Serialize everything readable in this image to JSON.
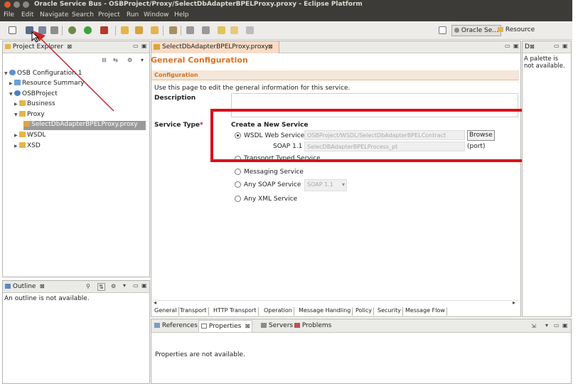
{
  "window": {
    "title": "Oracle Service Bus - OSBProject/Proxy/SelectDbAdapterBPELProxy.proxy - Eclipse Platform",
    "buttons": {
      "close_color": "#e05a2b",
      "min_color": "#8a887f",
      "max_color": "#8a887f"
    }
  },
  "menu": {
    "items": [
      "File",
      "Edit",
      "Navigate",
      "Search",
      "Project",
      "Run",
      "Window",
      "Help"
    ]
  },
  "toolbar": {
    "perspective_oracle": "Oracle Se...",
    "perspective_resource": "Resource"
  },
  "project_explorer": {
    "tab_label": "Project Explorer",
    "tree": {
      "root": "OSB Configuration 1",
      "resource_summary": "Resource Summary",
      "project": "OSBProject",
      "business": "Business",
      "proxy": "Proxy",
      "proxy_file": "SelectDbAdapterBPELProxy.proxy",
      "wsdl": "WSDL",
      "xsd": "XSD"
    }
  },
  "outline": {
    "tab_label": "Outline",
    "message": "An outline is not available."
  },
  "palette": {
    "tab_label": "D",
    "message_line1": "A palette is",
    "message_line2": "not available."
  },
  "editor": {
    "tab_label": "SelectDbAdapterBPELProxy.proxy",
    "heading": "General Configuration",
    "section": "Configuration",
    "intro": "Use this page to edit the general information for this service.",
    "description_label": "Description",
    "service_type_label": "Service Type",
    "required_mark": "*",
    "create_heading": "Create a New Service",
    "options": {
      "wsdl": "WSDL Web Service",
      "transport_typed": "Transport Typed Service",
      "messaging": "Messaging Service",
      "any_soap": "Any SOAP Service",
      "any_xml": "Any XML Service"
    },
    "wsdl_path": "OSBProject/WSDL/SelectDbAdapterBPELContract",
    "browse_label": "Browse",
    "soap_label": "SOAP 1.1",
    "port_value": "SelecDBAdapterBPELProcess_pt",
    "port_label": "(port)",
    "soap_select_value": "SOAP 1.1",
    "highlight_color": "#d8111b",
    "bottom_tabs": [
      "General",
      "Transport",
      "HTTP Transport",
      "Operation",
      "Message Handling",
      "Policy",
      "Security",
      "Message Flow"
    ]
  },
  "views": {
    "tabs": [
      "References",
      "Properties",
      "Servers",
      "Problems"
    ],
    "message": "Properties are not available."
  },
  "annotation": {
    "arrow_color": "#c8282c"
  }
}
